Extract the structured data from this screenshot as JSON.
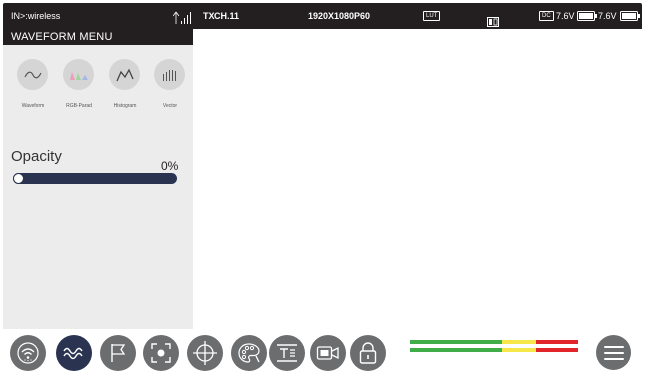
{
  "status_bar": {
    "input": "IN>:wireless",
    "signal_icon": "signal-bars-icon",
    "tx": "TX",
    "channel": "CH.11",
    "format": "1920X1080P60",
    "lut_badge": "LUT",
    "function_icon": "function-icon",
    "dc_badge": "DC",
    "voltage_1": "7.6V",
    "voltage_2": "7.6V"
  },
  "waveform_menu": {
    "title": "WAVEFORM MENU",
    "options": [
      {
        "label": "Waveform",
        "icon": "waveform-icon"
      },
      {
        "label": "RGB-Parad",
        "icon": "rgb-parade-icon"
      },
      {
        "label": "Histogram",
        "icon": "histogram-icon"
      },
      {
        "label": "Vector",
        "icon": "vector-icon"
      }
    ],
    "opacity": {
      "label": "Opacity",
      "value": "0%",
      "level": 0
    }
  },
  "toolbar": {
    "buttons": [
      {
        "icon": "wireless-icon",
        "active": false
      },
      {
        "icon": "waveform-icon",
        "active": true
      },
      {
        "icon": "flag-icon",
        "active": false
      },
      {
        "icon": "focus-frame-icon",
        "active": false
      },
      {
        "icon": "crosshair-icon",
        "active": false
      },
      {
        "icon": "color-palette-icon",
        "active": false
      },
      {
        "icon": "text-overlay-icon",
        "active": false
      },
      {
        "icon": "camera-icon",
        "active": false
      },
      {
        "icon": "lock-icon",
        "active": false
      }
    ],
    "audio_meter": {
      "channels": 2
    },
    "menu_icon": "hamburger-menu-icon"
  },
  "colors": {
    "bar_dark": "#231f20",
    "accent_navy": "#2a3450",
    "button_gray": "#6c6d6f",
    "panel_bg": "#ececed",
    "meter_green": "#3fae49",
    "meter_yellow": "#f5e74a",
    "meter_red": "#e1252a"
  }
}
